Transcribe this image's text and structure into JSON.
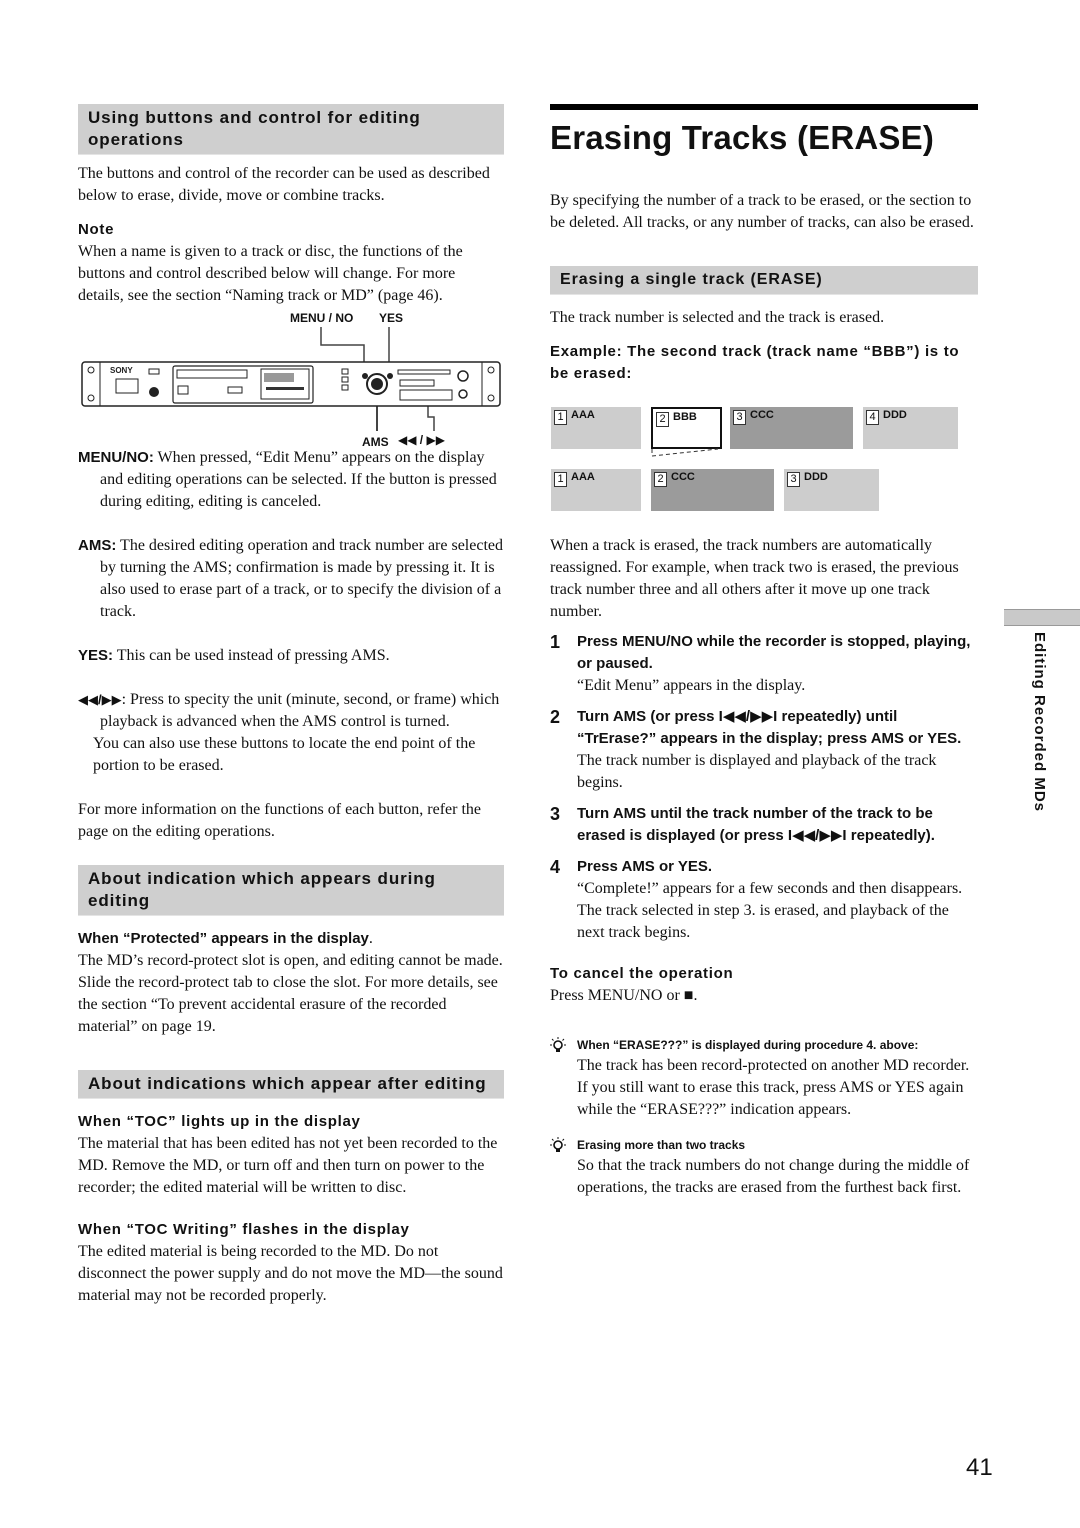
{
  "left": {
    "section1": {
      "heading": "Using buttons and control for editing operations",
      "intro": "The buttons and control of the recorder can be used as described below to erase, divide, move or combine tracks.",
      "note_label": "Note",
      "note_text": "When a name is given to a track or disc, the functions of the buttons and control described below will change. For more details, see the section “Naming track or MD” (page 46).",
      "figure": {
        "callout_menu_no": "MENU / NO",
        "callout_yes": "YES",
        "callout_ams": "AMS",
        "callout_rew_ff": "◀◀ / ▶▶",
        "brand": "SONY"
      },
      "items": [
        {
          "term": "MENU/NO:",
          "text": "When pressed, “Edit Menu” appears on the display and editing operations can be selected. If the button is pressed during editing, editing is canceled."
        },
        {
          "term": "AMS:",
          "text": "The desired editing operation and track number are selected by turning the AMS; confirmation is made by pressing it. It is also used to erase part of a track, or to specify the division of a track."
        },
        {
          "term": "YES:",
          "text": "This can be used instead of pressing AMS."
        },
        {
          "term": "◀◀/▶▶",
          "text": ": Press to specity the unit (minute, second, or frame) which playback is advanced when the AMS control is turned.",
          "extra": "You can also use these buttons to locate the end point of the portion to be erased."
        }
      ],
      "more_info": "For more information on the functions of each button, refer the page on the editing operations."
    },
    "section2": {
      "heading": "About indication which appears during editing",
      "sub_heading": "When “Protected” appears in the display",
      "sub_heading_tail": ".",
      "text": "The MD’s record-protect slot is open, and editing cannot be made. Slide the record-protect tab to close the slot. For more details, see the section “To prevent accidental erasure of the recorded material” on page 19."
    },
    "section3": {
      "heading": "About indications which appear after editing",
      "sub1_heading": "When “TOC” lights up in the display",
      "sub1_text": "The material that has been edited has not yet been recorded to the MD. Remove the MD, or turn off and then turn on power to the recorder; the edited material will be written to disc.",
      "sub2_heading": "When “TOC Writing” flashes in the display",
      "sub2_text": "The edited material is being recorded to the MD. Do not disconnect the power supply and do not move the MD—the sound material may not be recorded properly."
    }
  },
  "right": {
    "title": "Erasing Tracks (ERASE)",
    "intro": "By specifying the number of a track to be erased, or the section to be deleted. All tracks, or any number of tracks, can also be erased.",
    "section_heading": "Erasing a single track (ERASE)",
    "section_intro": "The track number is selected and the track is erased.",
    "example_heading": "Example: The second track (track name “BBB”) is to be erased:",
    "diagram": {
      "before": [
        {
          "num": "1",
          "name": "AAA",
          "shade": "light"
        },
        {
          "num": "2",
          "name": "BBB",
          "shade": "erased"
        },
        {
          "num": "3",
          "name": "CCC",
          "shade": "dark"
        },
        {
          "num": "4",
          "name": "DDD",
          "shade": "light"
        }
      ],
      "after": [
        {
          "num": "1",
          "name": "AAA",
          "shade": "light"
        },
        {
          "num": "2",
          "name": "CCC",
          "shade": "dark"
        },
        {
          "num": "3",
          "name": "DDD",
          "shade": "light"
        }
      ]
    },
    "renumber_text": "When a track is erased, the track numbers are automatically reassigned. For example, when track two is erased, the previous track number three and all others after it move up one track number.",
    "steps": [
      {
        "num": "1",
        "instruction": "Press MENU/NO while the recorder is stopped, playing, or paused.",
        "result": "“Edit Menu” appears in the display."
      },
      {
        "num": "2",
        "instruction": "Turn AMS (or press I◀◀/▶▶I repeatedly) until “TrErase?” appears in the display; press AMS or YES.",
        "result": "The track number is displayed and playback of the track begins."
      },
      {
        "num": "3",
        "instruction": "Turn AMS until the track number of the track to be erased is displayed (or press I◀◀/▶▶I repeatedly).",
        "result": ""
      },
      {
        "num": "4",
        "instruction": "Press AMS or YES.",
        "result": "“Complete!” appears for a few seconds and then disappears. The track selected in step 3. is erased, and playback of the next track begins."
      }
    ],
    "cancel_heading": "To cancel the operation",
    "cancel_text": "Press MENU/NO or ■.",
    "tips": [
      {
        "title": "When “ERASE???” is displayed during procedure 4. above:",
        "text": "The track has been record-protected on another MD recorder. If you still want to erase this track, press AMS or YES again while the “ERASE???” indication appears."
      },
      {
        "title": "Erasing more than two tracks",
        "text": "So that the track numbers do not change during the middle of operations, the tracks are erased from the furthest back first."
      }
    ]
  },
  "side_tab": "Editing Recorded MDs",
  "page_number": "41"
}
